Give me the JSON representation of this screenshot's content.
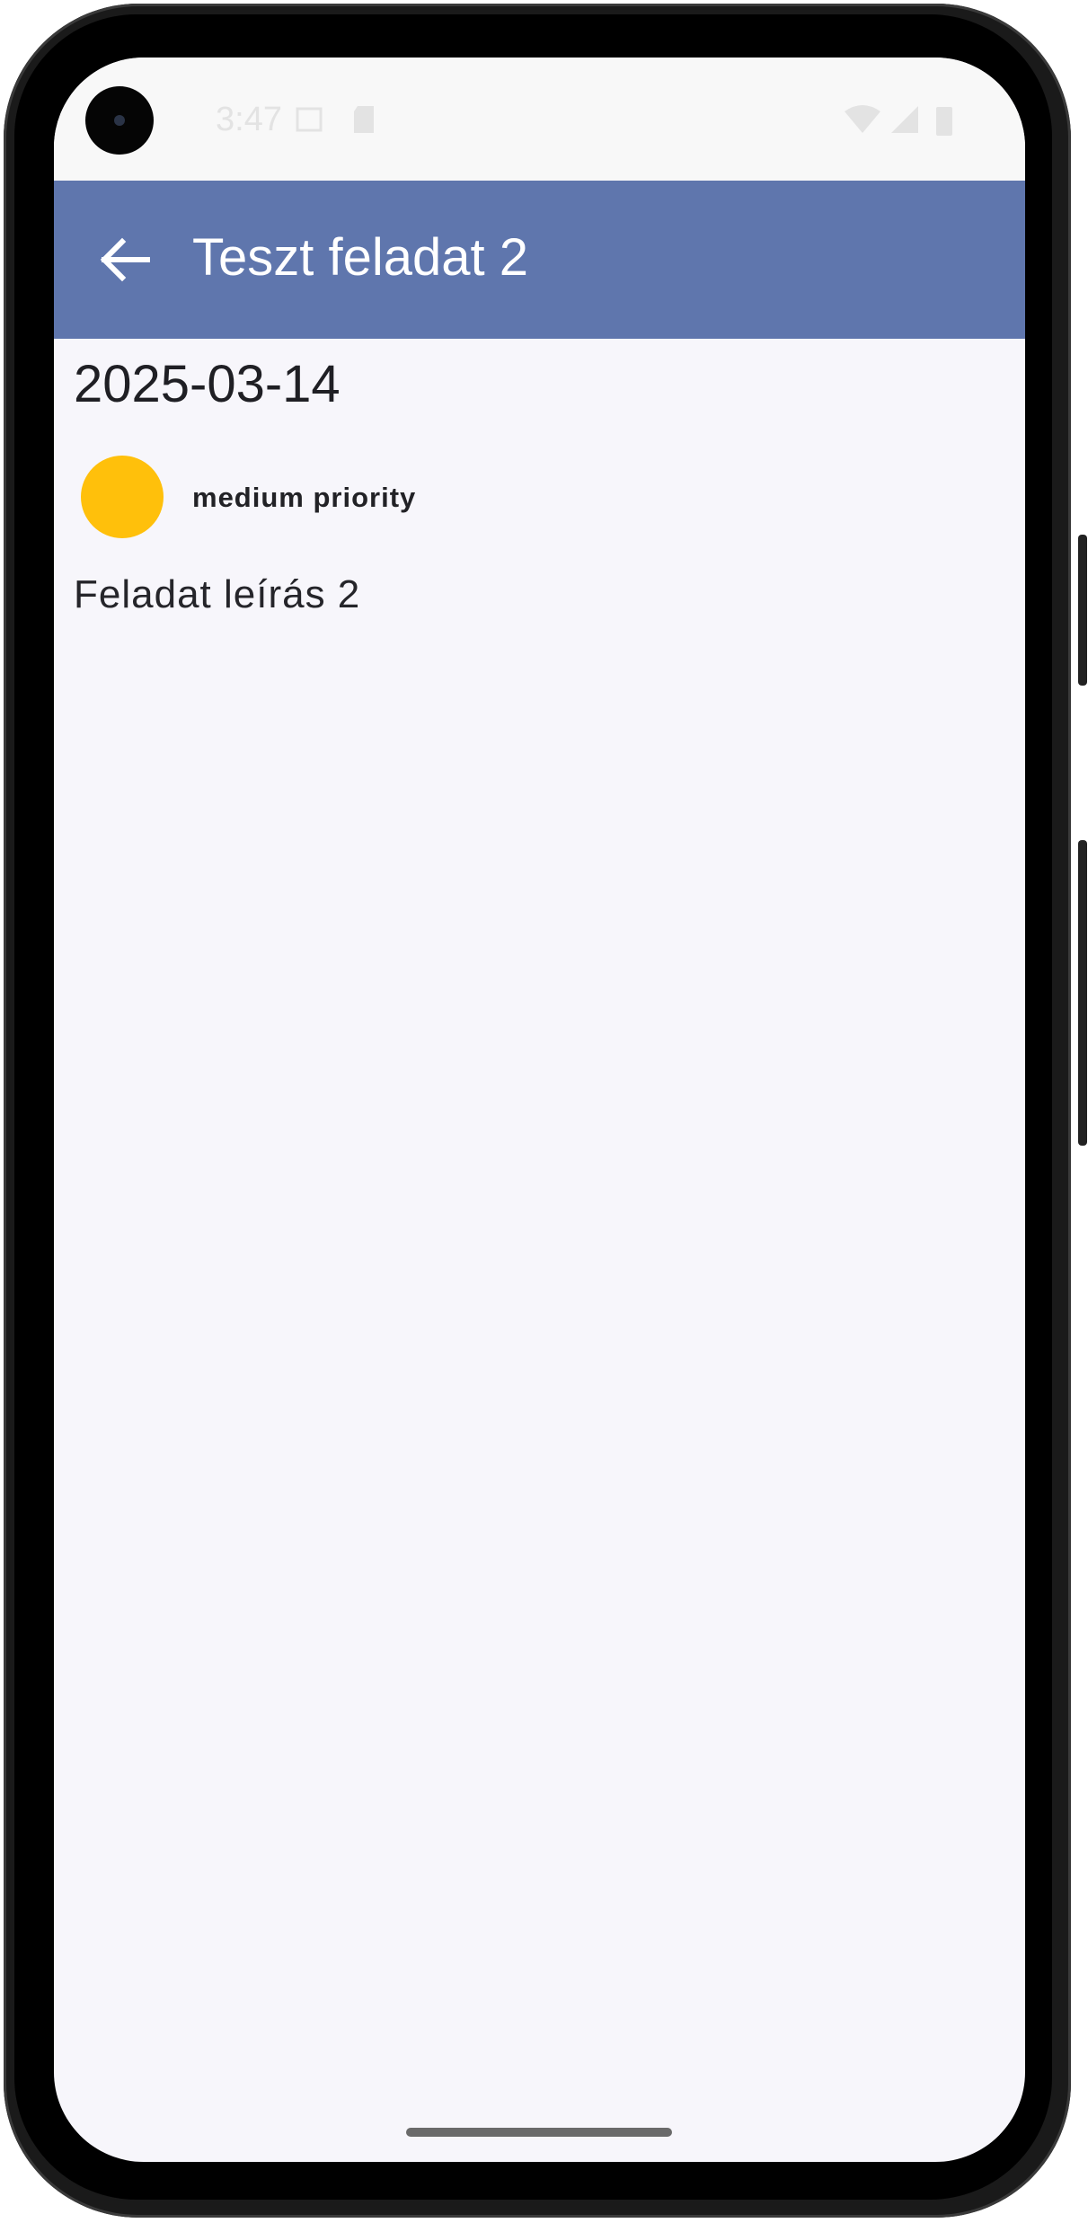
{
  "status_bar": {
    "time": "3:47"
  },
  "app_bar": {
    "title": "Teszt feladat 2",
    "back_icon": "arrow-back-icon"
  },
  "task": {
    "date": "2025-03-14",
    "priority_label": "medium priority",
    "priority_color": "#FFC00B",
    "description": "Feladat leírás 2"
  },
  "colors": {
    "app_bar": "#5F76AD",
    "background": "#F7F6FB"
  }
}
